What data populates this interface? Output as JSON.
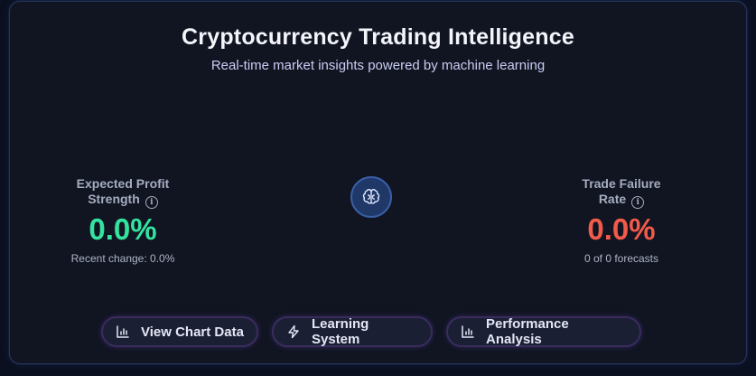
{
  "header": {
    "title": "Cryptocurrency Trading Intelligence",
    "subtitle": "Real-time market insights powered by machine learning"
  },
  "metrics": {
    "profit": {
      "label_line1": "Expected Profit",
      "label_line2": "Strength",
      "value": "0.0%",
      "sub": "Recent change: 0.0%",
      "color": "#34e3a0"
    },
    "failure": {
      "label_line1": "Trade Failure",
      "label_line2": "Rate",
      "value": "0.0%",
      "sub": "0 of 0 forecasts",
      "color": "#f25a4a"
    }
  },
  "center": {
    "icon": "brain-icon"
  },
  "actions": [
    {
      "label": "View Chart Data",
      "icon": "bar-chart-icon"
    },
    {
      "label": "Learning System",
      "icon": "lightning-icon"
    },
    {
      "label": "Performance Analysis",
      "icon": "bar-chart-icon"
    }
  ]
}
